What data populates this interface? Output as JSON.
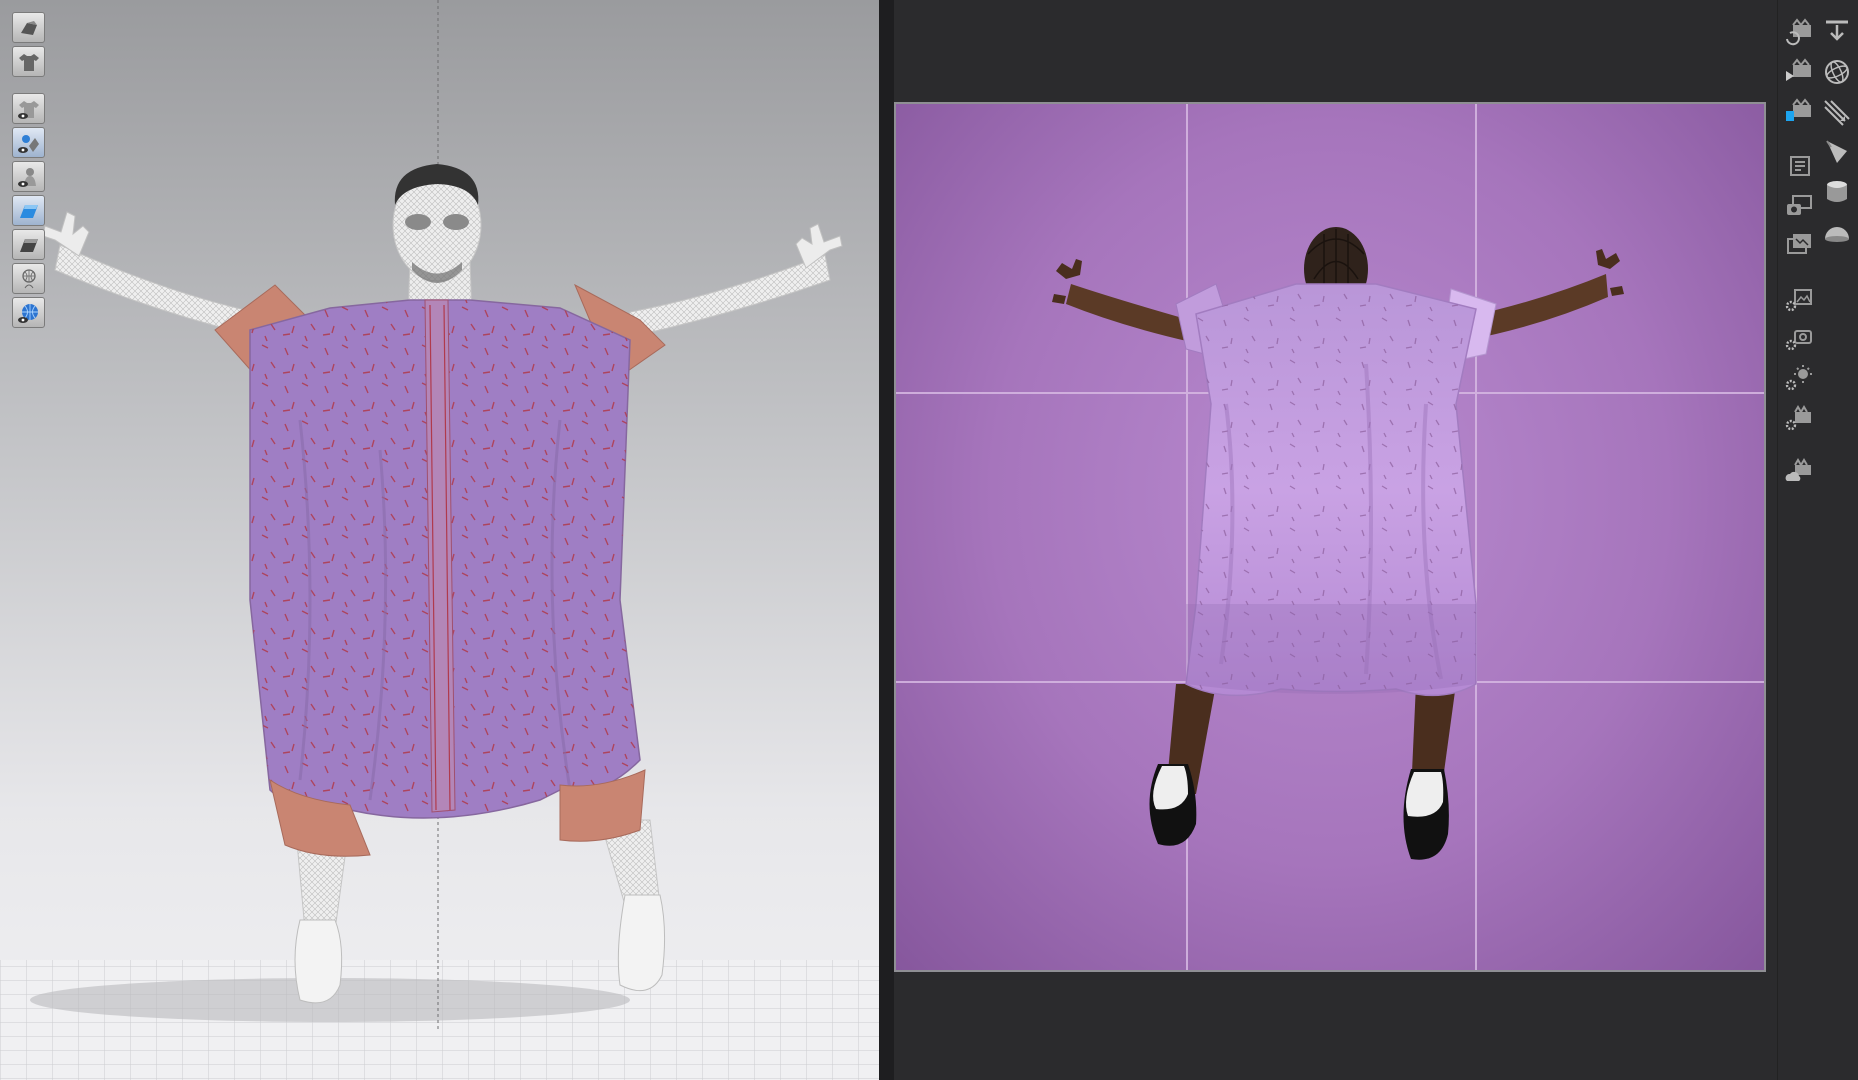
{
  "left_toolbar": {
    "tools": [
      {
        "icon": "avatar-display-icon"
      },
      {
        "icon": "garment-display-icon"
      },
      {
        "icon": "show-garment-icon"
      },
      {
        "icon": "show-texture-icon",
        "active": true
      },
      {
        "icon": "show-avatar-icon"
      },
      {
        "icon": "shaded-mode-icon",
        "active": true
      },
      {
        "icon": "solid-mode-icon"
      },
      {
        "icon": "wireframe-avatar-icon"
      },
      {
        "icon": "environment-globe-icon"
      }
    ]
  },
  "right_toolbar": {
    "col1": [
      "refresh-render-icon",
      "play-render-icon",
      "render-clapper-icon",
      "render-list-icon",
      "snapshot-camera-icon",
      "image-gallery-icon",
      "environment-settings-icon",
      "camera-settings-icon",
      "light-settings-icon",
      "animation-settings-icon",
      "cloud-render-icon"
    ],
    "col2": [
      "download-icon",
      "sphere-icon",
      "directional-light-icon",
      "spot-light-icon",
      "cylinder-icon",
      "dome-light-icon"
    ]
  },
  "colors": {
    "garment": "#9f7ec4",
    "cuff": "#c98572",
    "render_background": "#a675bc",
    "render_garment": "#c9a2e4",
    "skin": "#5b3a26"
  }
}
